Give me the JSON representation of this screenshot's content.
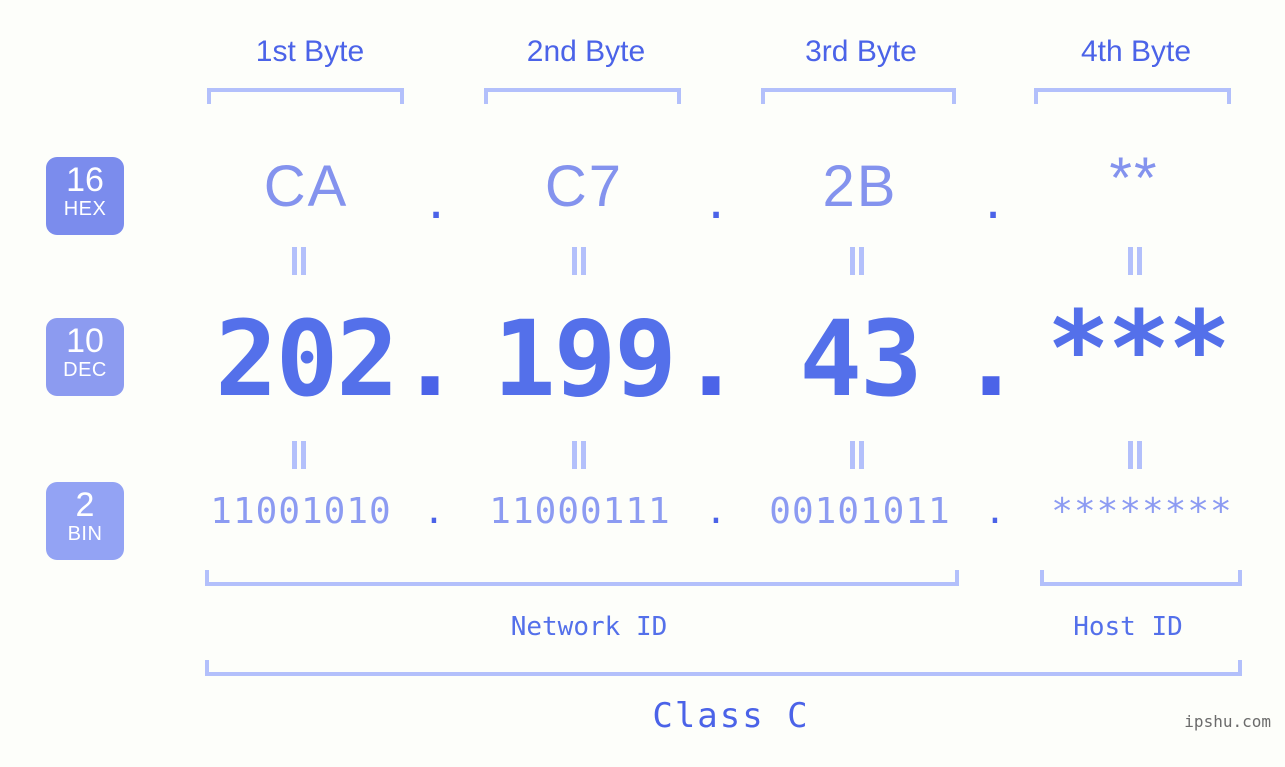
{
  "page": {
    "background_color": "#fdfefa",
    "accent_color": "#4b63e8",
    "light_accent_color": "#b3c0fb",
    "watermark": "ipshu.com"
  },
  "byte_headers": [
    {
      "label": "1st Byte"
    },
    {
      "label": "2nd Byte"
    },
    {
      "label": "3rd Byte"
    },
    {
      "label": "4th Byte"
    }
  ],
  "bases": [
    {
      "number": "16",
      "name": "HEX",
      "color": "#7b8ced"
    },
    {
      "number": "10",
      "name": "DEC",
      "color": "#8c9bf0"
    },
    {
      "number": "2",
      "name": "BIN",
      "color": "#93a3f4"
    }
  ],
  "separator": {
    "dot": ".",
    "equals": "="
  },
  "rows": {
    "hex": {
      "base_label": "HEX",
      "values": [
        "CA",
        "C7",
        "2B",
        "**"
      ]
    },
    "dec": {
      "base_label": "DEC",
      "values": [
        "202",
        "199",
        "43",
        "***"
      ]
    },
    "bin": {
      "base_label": "BIN",
      "values": [
        "11001010",
        "11000111",
        "00101011",
        "********"
      ]
    }
  },
  "segments": {
    "network_id": "Network ID",
    "host_id": "Host ID",
    "class": "Class C"
  }
}
